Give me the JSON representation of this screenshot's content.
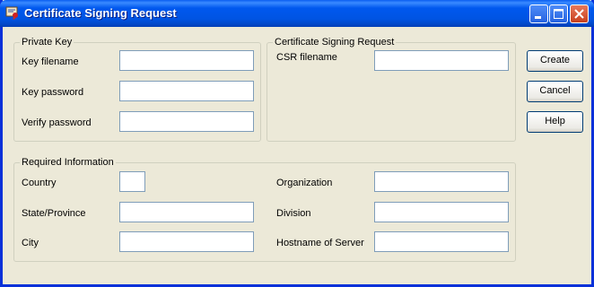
{
  "window": {
    "title": "Certificate Signing Request",
    "icon": "certificate-app-icon",
    "controls": [
      "minimize-icon",
      "maximize-icon",
      "close-icon"
    ]
  },
  "private_key": {
    "legend": "Private Key",
    "key_filename_label": "Key filename",
    "key_filename_value": "",
    "key_password_label": "Key password",
    "key_password_value": "",
    "verify_password_label": "Verify password",
    "verify_password_value": ""
  },
  "csr": {
    "legend": "Certificate Signing Request",
    "csr_filename_label": "CSR filename",
    "csr_filename_value": ""
  },
  "required": {
    "legend": "Required Information",
    "country_label": "Country",
    "country_value": "",
    "state_label": "State/Province",
    "state_value": "",
    "city_label": "City",
    "city_value": "",
    "organization_label": "Organization",
    "organization_value": "",
    "division_label": "Division",
    "division_value": "",
    "hostname_label": "Hostname of Server",
    "hostname_value": ""
  },
  "buttons": {
    "create": "Create",
    "cancel": "Cancel",
    "help": "Help"
  },
  "colors": {
    "titlebar": "#0054E3",
    "dialog_bg": "#ECE9D8",
    "input_border": "#7F9DB9",
    "button_border": "#003C74"
  }
}
